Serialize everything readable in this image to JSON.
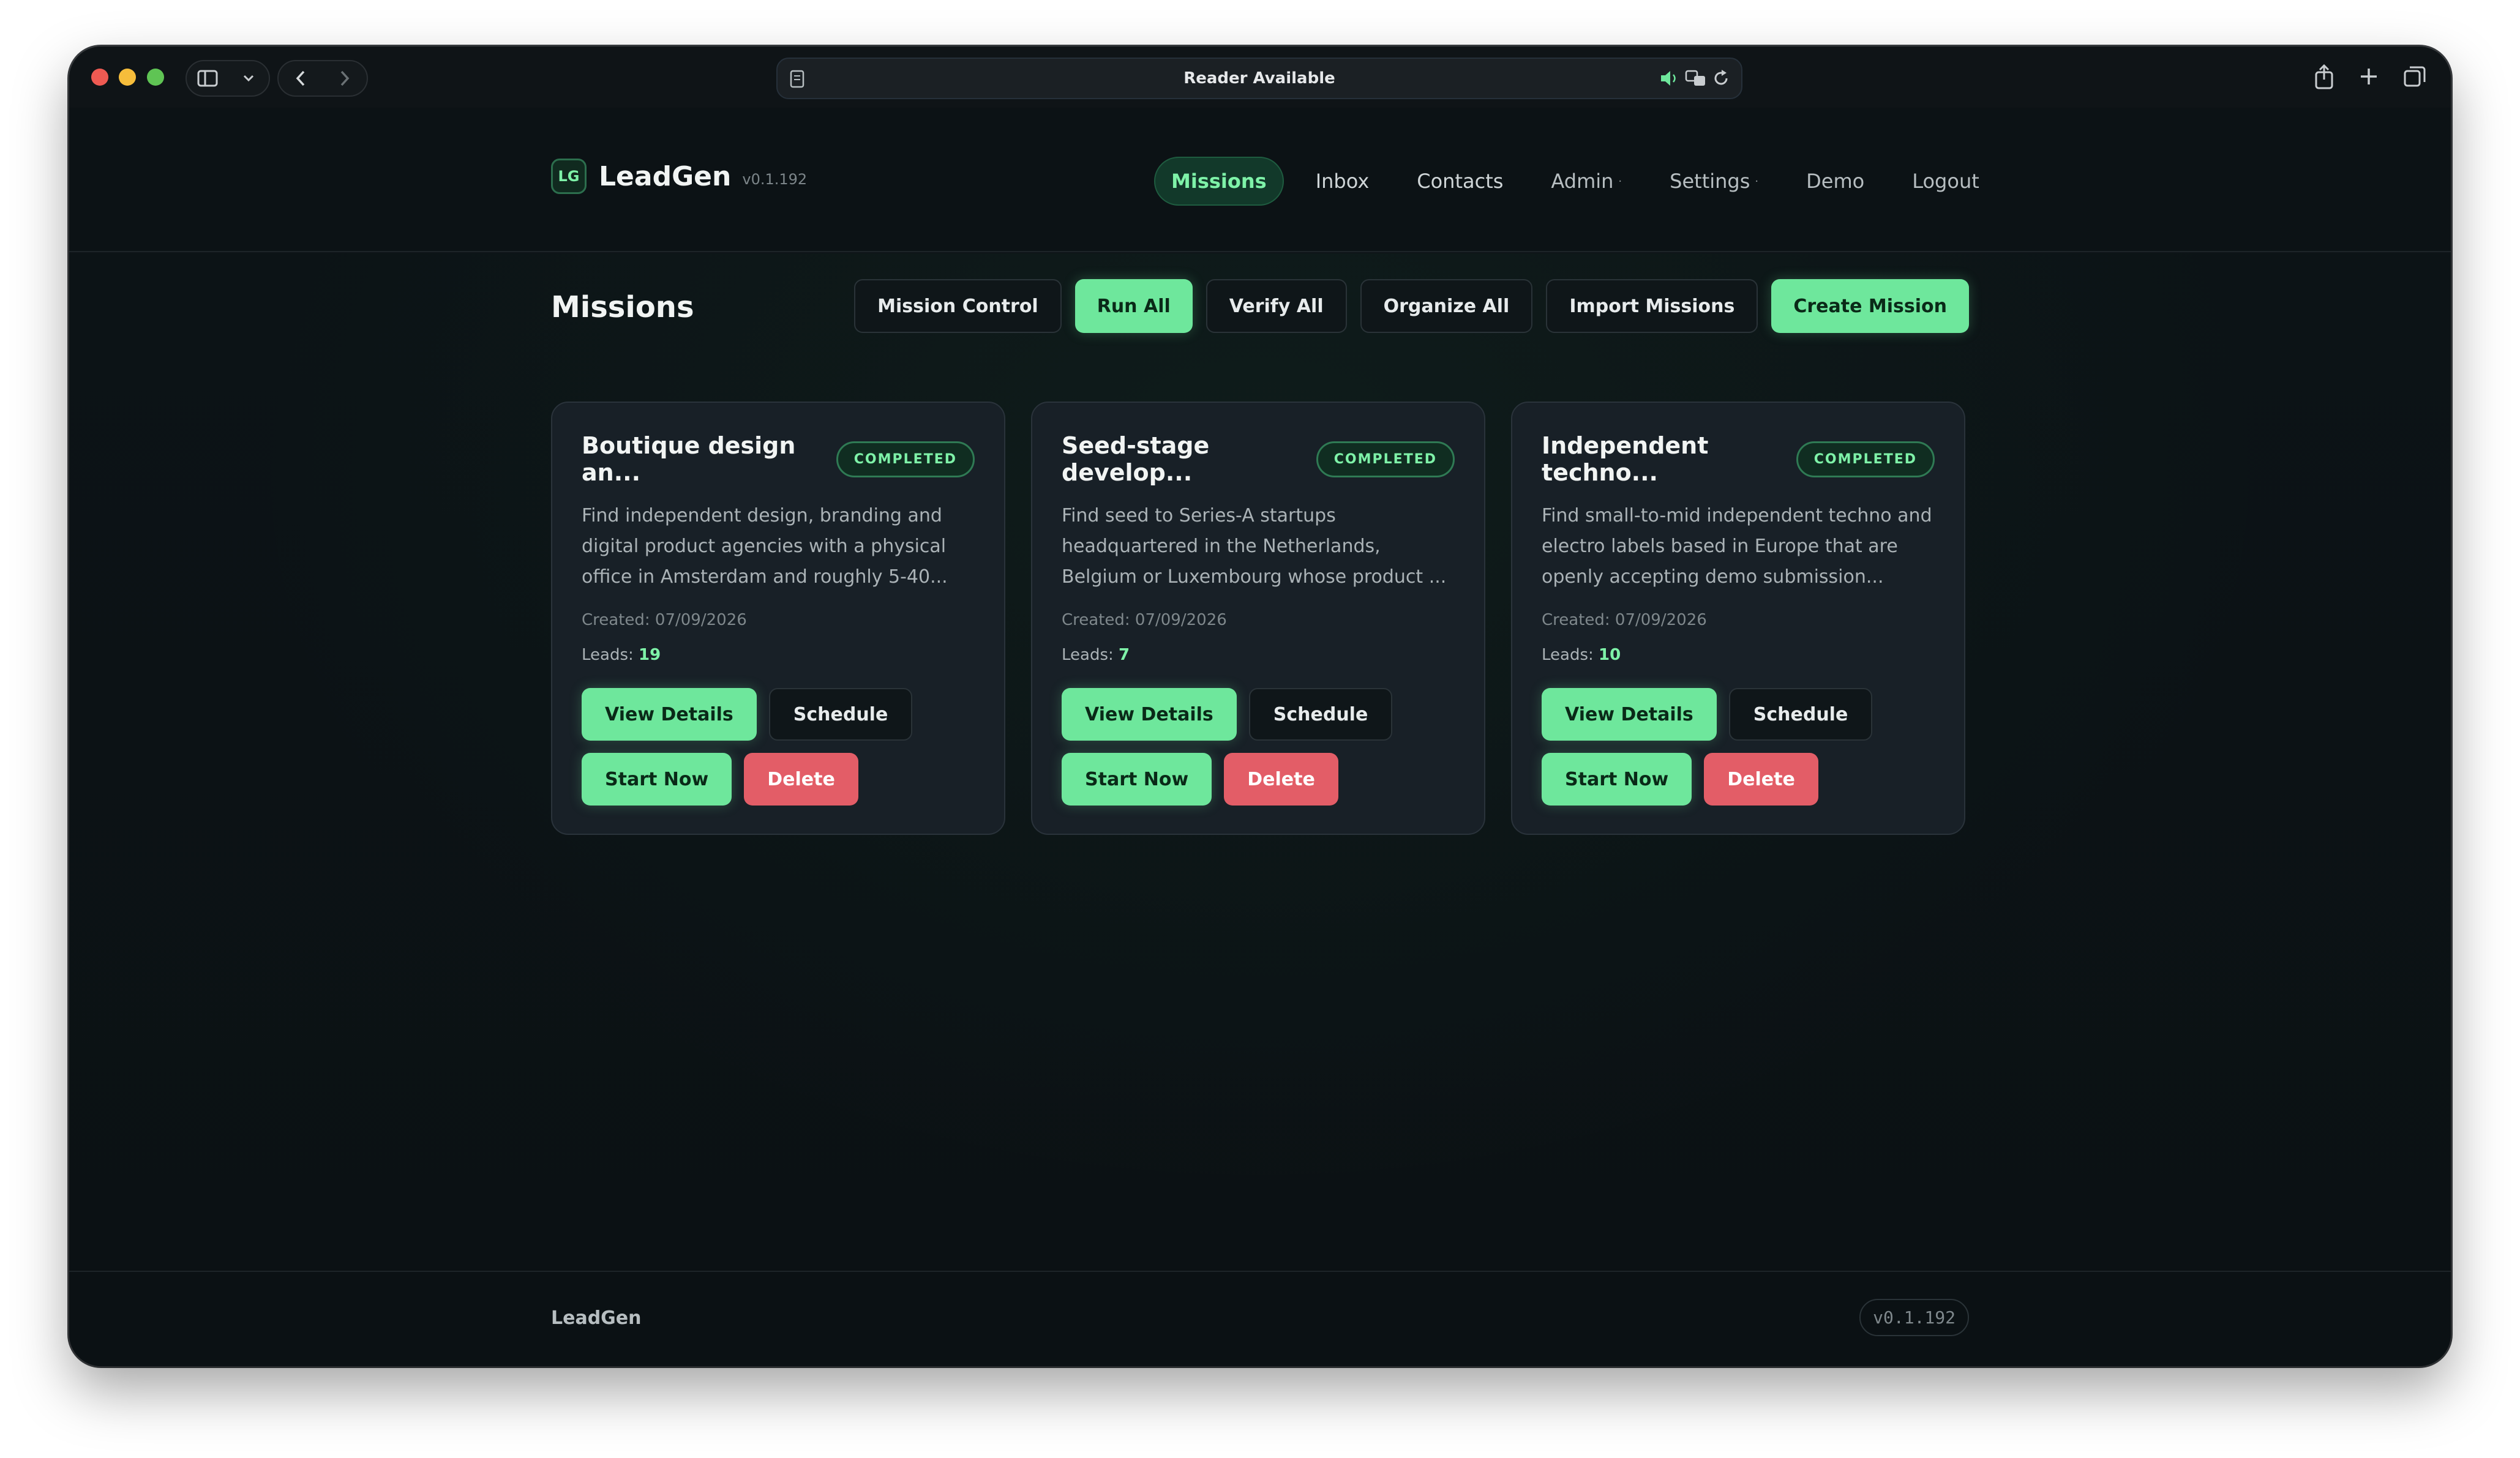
{
  "browser": {
    "address_text": "Reader Available"
  },
  "app": {
    "logo": "LG",
    "name": "LeadGen",
    "version": "v0.1.192"
  },
  "nav": {
    "missions": "Missions",
    "inbox": "Inbox",
    "contacts": "Contacts",
    "admin": "Admin",
    "settings": "Settings",
    "demo": "Demo",
    "logout": "Logout",
    "caret": "·"
  },
  "page": {
    "title": "Missions",
    "actions": {
      "mission_control": "Mission Control",
      "run_all": "Run All",
      "verify_all": "Verify All",
      "organize_all": "Organize All",
      "import_missions": "Import Missions",
      "create_mission": "Create Mission"
    }
  },
  "missions": [
    {
      "title": "Boutique design an...",
      "status": "COMPLETED",
      "description": "Find independent design, branding and digital product agencies with a physical office in Amsterdam and roughly 5-40...",
      "created": "Created: 07/09/2026",
      "leads_label": "Leads:",
      "leads": "19",
      "view_details": "View Details",
      "schedule": "Schedule",
      "start_now": "Start Now",
      "delete": "Delete"
    },
    {
      "title": "Seed-stage develop...",
      "status": "COMPLETED",
      "description": "Find seed to Series-A startups headquartered in the Netherlands, Belgium or Luxembourg whose product ...",
      "created": "Created: 07/09/2026",
      "leads_label": "Leads:",
      "leads": "7",
      "view_details": "View Details",
      "schedule": "Schedule",
      "start_now": "Start Now",
      "delete": "Delete"
    },
    {
      "title": "Independent techno...",
      "status": "COMPLETED",
      "description": "Find small-to-mid independent techno and electro labels based in Europe that are openly accepting demo submission...",
      "created": "Created: 07/09/2026",
      "leads_label": "Leads:",
      "leads": "10",
      "view_details": "View Details",
      "schedule": "Schedule",
      "start_now": "Start Now",
      "delete": "Delete"
    }
  ],
  "footer": {
    "brand": "LeadGen",
    "version": "v0.1.192"
  },
  "colors": {
    "accent": "#6ee79c",
    "danger": "#e35d67",
    "background": "#0e1418",
    "card": "#182027"
  }
}
